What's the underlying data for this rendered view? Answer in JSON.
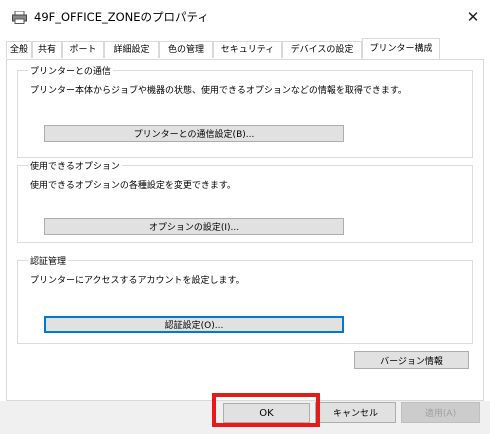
{
  "window": {
    "title": "49F_OFFICE_ZONEのプロパティ",
    "close_glyph": "✕"
  },
  "tabs": [
    {
      "label": "全般",
      "active": false
    },
    {
      "label": "共有",
      "active": false
    },
    {
      "label": "ポート",
      "active": false
    },
    {
      "label": "詳細設定",
      "active": false
    },
    {
      "label": "色の管理",
      "active": false
    },
    {
      "label": "セキュリティ",
      "active": false
    },
    {
      "label": "デバイスの設定",
      "active": false
    },
    {
      "label": "プリンター構成",
      "active": true
    }
  ],
  "groups": {
    "comm": {
      "legend": "プリンターとの通信",
      "description": "プリンター本体からジョブや機器の状態、使用できるオプションなどの情報を取得できます。",
      "button": "プリンターとの通信設定(B)..."
    },
    "options": {
      "legend": "使用できるオプション",
      "description": "使用できるオプションの各種設定を変更できます。",
      "button": "オプションの設定(I)..."
    },
    "auth": {
      "legend": "認証管理",
      "description": "プリンターにアクセスするアカウントを設定します。",
      "button": "認証設定(O)..."
    }
  },
  "version_button": "バージョン情報",
  "footer": {
    "ok": "OK",
    "cancel": "キャンセル",
    "apply": "適用(A)"
  },
  "colors": {
    "highlight": "#e41b17",
    "focus": "#0078d7"
  }
}
